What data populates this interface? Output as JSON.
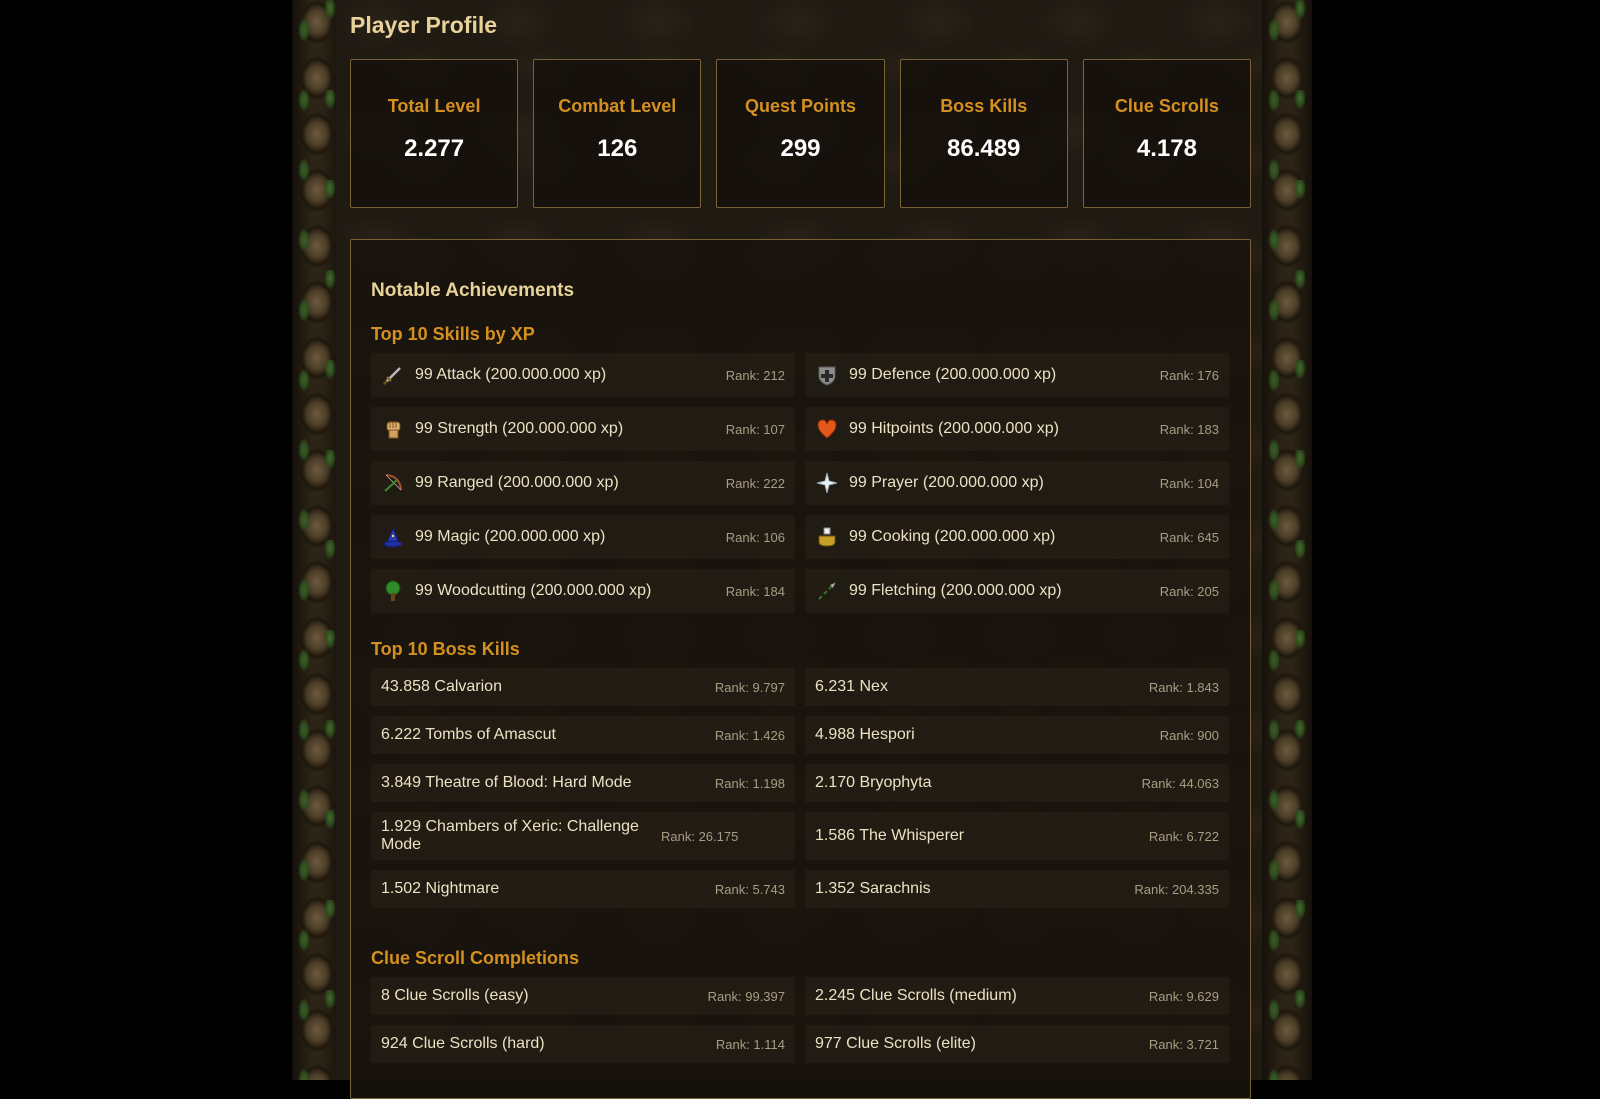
{
  "header": {
    "title": "Player Profile"
  },
  "stats": [
    {
      "label": "Total Level",
      "value": "2.277"
    },
    {
      "label": "Combat Level",
      "value": "126"
    },
    {
      "label": "Quest Points",
      "value": "299"
    },
    {
      "label": "Boss Kills",
      "value": "86.489"
    },
    {
      "label": "Clue Scrolls",
      "value": "4.178"
    }
  ],
  "achievements": {
    "title": "Notable Achievements",
    "skills_title": "Top 10 Skills by XP",
    "skills": [
      {
        "icon": "attack-sword-icon",
        "label": "99 Attack (200.000.000 xp)",
        "rank": "Rank: 212"
      },
      {
        "icon": "defence-shield-icon",
        "label": "99 Defence (200.000.000 xp)",
        "rank": "Rank: 176"
      },
      {
        "icon": "strength-fist-icon",
        "label": "99 Strength (200.000.000 xp)",
        "rank": "Rank: 107"
      },
      {
        "icon": "hitpoints-heart-icon",
        "label": "99 Hitpoints (200.000.000 xp)",
        "rank": "Rank: 183"
      },
      {
        "icon": "ranged-bow-icon",
        "label": "99 Ranged (200.000.000 xp)",
        "rank": "Rank: 222"
      },
      {
        "icon": "prayer-star-icon",
        "label": "99 Prayer (200.000.000 xp)",
        "rank": "Rank: 104"
      },
      {
        "icon": "magic-hat-icon",
        "label": "99 Magic (200.000.000 xp)",
        "rank": "Rank: 106"
      },
      {
        "icon": "cooking-pot-icon",
        "label": "99 Cooking (200.000.000 xp)",
        "rank": "Rank: 645"
      },
      {
        "icon": "woodcutting-tree-icon",
        "label": "99 Woodcutting (200.000.000 xp)",
        "rank": "Rank: 184"
      },
      {
        "icon": "fletching-arrow-icon",
        "label": "99 Fletching (200.000.000 xp)",
        "rank": "Rank: 205"
      }
    ],
    "boss_title": "Top 10 Boss Kills",
    "bosses": [
      {
        "label": "43.858 Calvarion",
        "rank": "Rank: 9.797"
      },
      {
        "label": "6.231 Nex",
        "rank": "Rank: 1.843"
      },
      {
        "label": "6.222 Tombs of Amascut",
        "rank": "Rank: 1.426"
      },
      {
        "label": "4.988 Hespori",
        "rank": "Rank: 900"
      },
      {
        "label": "3.849 Theatre of Blood: Hard Mode",
        "rank": "Rank: 1.198"
      },
      {
        "label": "2.170 Bryophyta",
        "rank": "Rank: 44.063"
      },
      {
        "label": "1.929 Chambers of Xeric: Challenge Mode",
        "rank": "Rank: 26.175"
      },
      {
        "label": "1.586 The Whisperer",
        "rank": "Rank: 6.722"
      },
      {
        "label": "1.502 Nightmare",
        "rank": "Rank: 5.743"
      },
      {
        "label": "1.352 Sarachnis",
        "rank": "Rank: 204.335"
      }
    ],
    "clue_title": "Clue Scroll Completions",
    "clues": [
      {
        "label": "8 Clue Scrolls (easy)",
        "rank": "Rank: 99.397"
      },
      {
        "label": "2.245 Clue Scrolls (medium)",
        "rank": "Rank: 9.629"
      },
      {
        "label": "924 Clue Scrolls (hard)",
        "rank": "Rank: 1.114"
      },
      {
        "label": "977 Clue Scrolls (elite)",
        "rank": "Rank: 3.721"
      }
    ]
  }
}
